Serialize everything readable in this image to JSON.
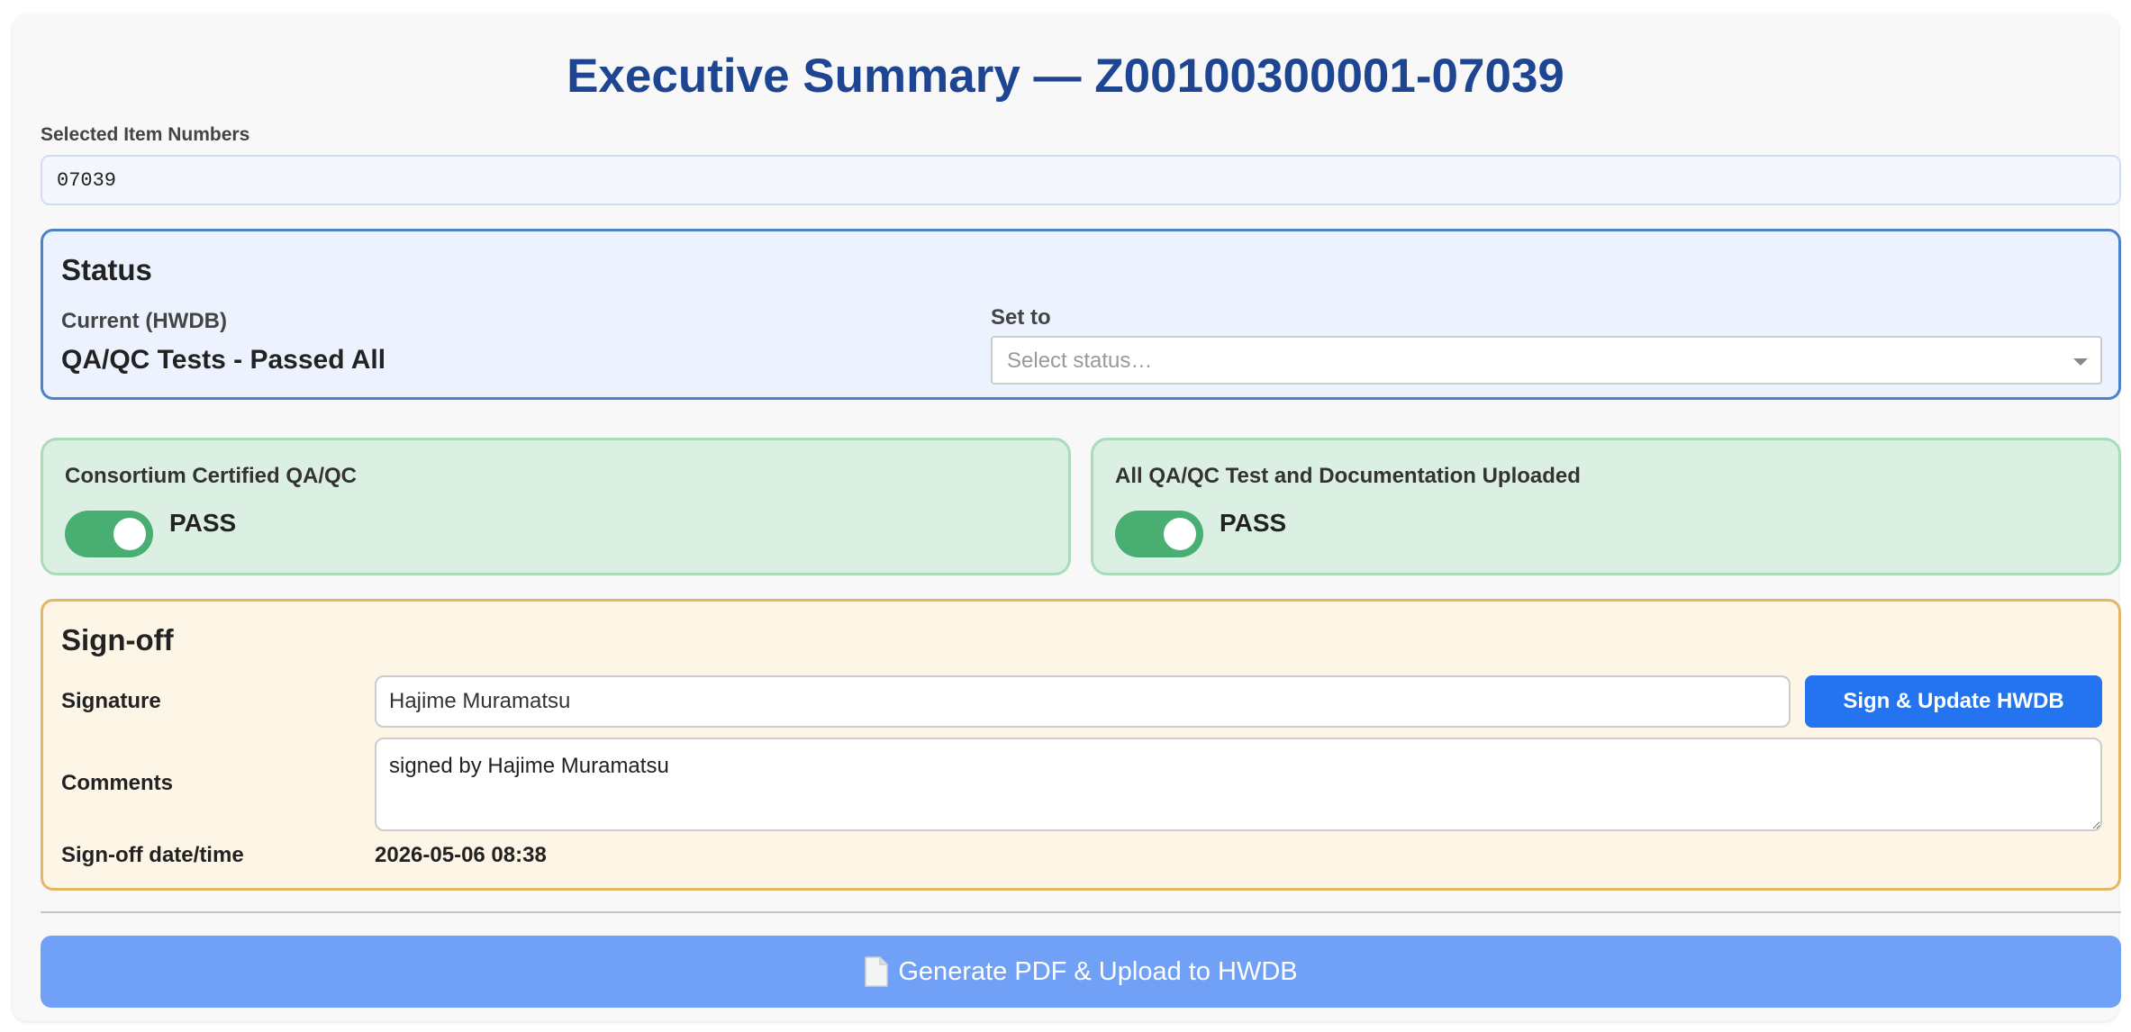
{
  "header": {
    "title": "Executive Summary — Z00100300001-07039"
  },
  "items": {
    "label": "Selected Item Numbers",
    "value": "07039"
  },
  "status": {
    "heading": "Status",
    "current_label": "Current (HWDB)",
    "current_value": "QA/QC Tests - Passed All",
    "set_to_label": "Set to",
    "select_placeholder": "Select status…"
  },
  "checks": [
    {
      "title": "Consortium Certified QA/QC",
      "state_label": "PASS",
      "enabled": true
    },
    {
      "title": "All QA/QC Test and Documentation Uploaded",
      "state_label": "PASS",
      "enabled": true
    }
  ],
  "signoff": {
    "heading": "Sign-off",
    "signature_label": "Signature",
    "signature_value": "Hajime Muramatsu",
    "sign_button": "Sign & Update HWDB",
    "comments_label": "Comments",
    "comments_value": "signed by Hajime Muramatsu",
    "datetime_label": "Sign-off date/time",
    "datetime_value": "2026-05-06 08:38"
  },
  "footer": {
    "generate_button": "Generate PDF & Upload to HWDB",
    "generate_icon": "document-icon"
  },
  "colors": {
    "title": "#1d4591",
    "status_border": "#4d82c8",
    "status_bg": "#edf3fe",
    "pass_bg": "#dcefe3",
    "toggle_on": "#48ae72",
    "signoff_bg": "#fdf5e6",
    "signoff_border": "#e4b767",
    "primary_button": "#2474ef",
    "generate_button": "#70a1f6"
  }
}
